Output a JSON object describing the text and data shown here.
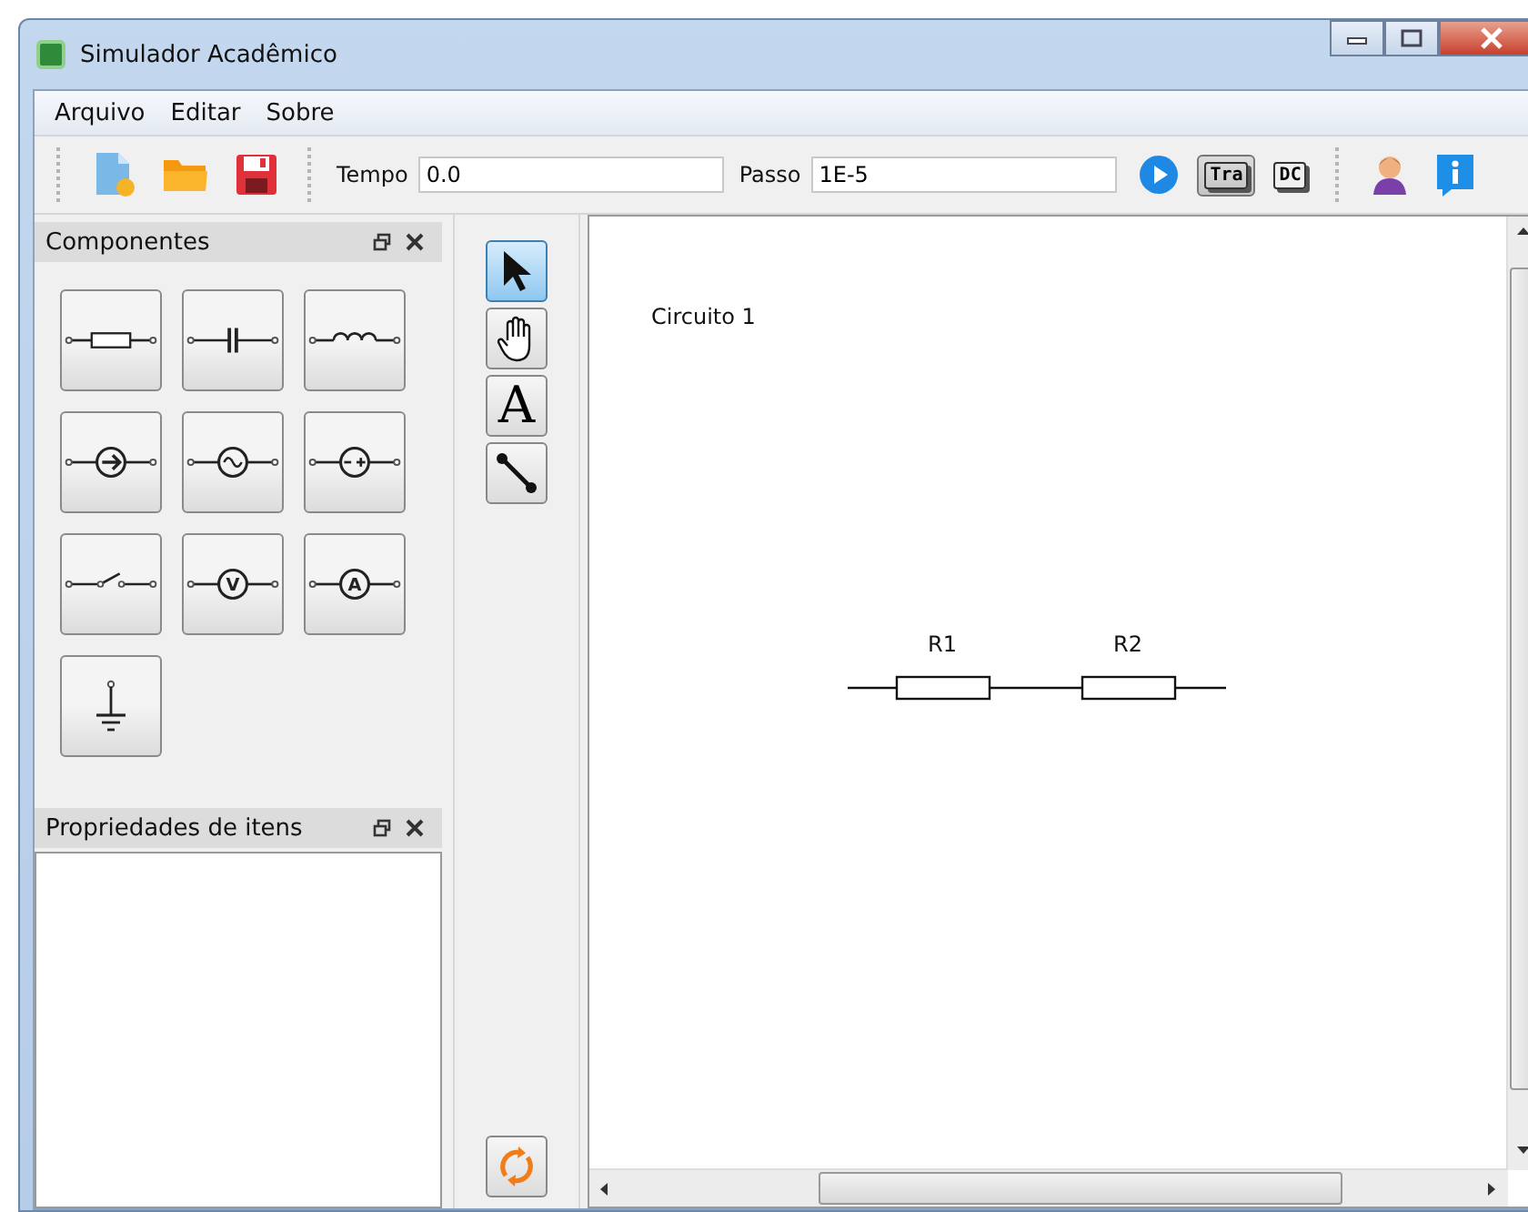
{
  "window": {
    "title": "Simulador Acadêmico"
  },
  "menu": [
    "Arquivo",
    "Editar",
    "Sobre"
  ],
  "toolbar": {
    "file_buttons": [
      {
        "kind": "new"
      },
      {
        "kind": "open"
      },
      {
        "kind": "save"
      }
    ],
    "fields": [
      {
        "label": "Tempo",
        "value": "0.0"
      },
      {
        "label": "Passo",
        "value": "1E-5"
      }
    ],
    "mode_buttons": [
      {
        "label": "Tra",
        "selected": true
      },
      {
        "label": "DC",
        "selected": false
      }
    ],
    "extra_buttons": [
      {
        "kind": "user"
      },
      {
        "kind": "info"
      }
    ]
  },
  "components_panel": {
    "title": "Componentes",
    "items": [
      {
        "kind": "resistor"
      },
      {
        "kind": "capacitor"
      },
      {
        "kind": "inductor"
      },
      {
        "kind": "current_source"
      },
      {
        "kind": "ac_source"
      },
      {
        "kind": "dc_source"
      },
      {
        "kind": "switch"
      },
      {
        "kind": "meter",
        "symbol": "V"
      },
      {
        "kind": "meter",
        "symbol": "A"
      },
      {
        "kind": "ground"
      }
    ]
  },
  "properties_panel": {
    "title": "Propriedades de itens"
  },
  "tools": [
    {
      "kind": "select",
      "selected": true
    },
    {
      "kind": "hand",
      "selected": false
    },
    {
      "kind": "text",
      "glyph": "A",
      "selected": false
    },
    {
      "kind": "wire",
      "selected": false
    }
  ],
  "canvas": {
    "title": "Circuito 1",
    "components": [
      {
        "kind": "resistor",
        "label": "R1"
      },
      {
        "kind": "resistor",
        "label": "R2"
      }
    ]
  }
}
